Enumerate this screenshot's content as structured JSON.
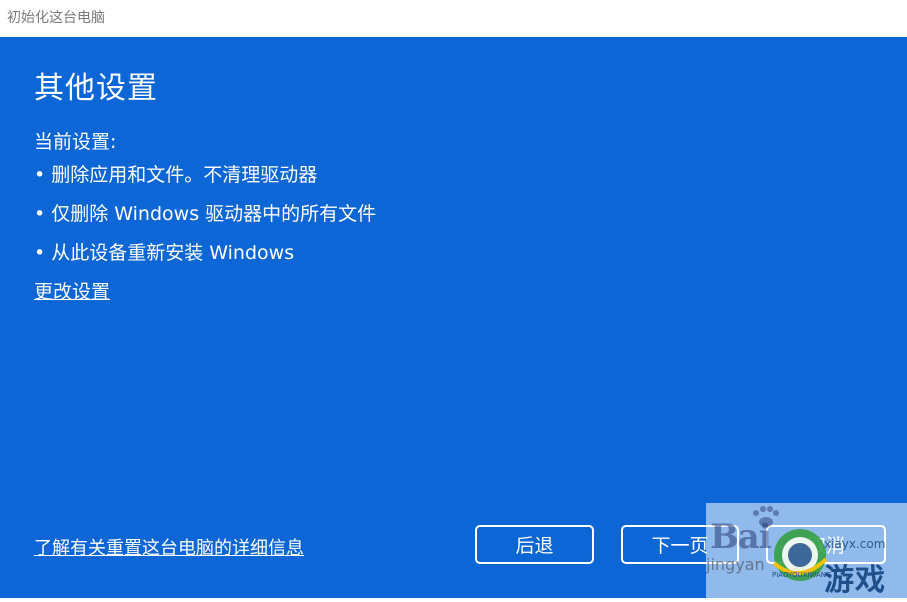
{
  "window": {
    "title": "初始化这台电脑"
  },
  "dialog": {
    "heading": "其他设置",
    "current_settings_label": "当前设置:",
    "bullets": [
      "• 删除应用和文件。不清理驱动器",
      "• 仅删除 Windows 驱动器中的所有文件",
      "•  从此设备重新安装 Windows"
    ],
    "change_settings_link": "更改设置",
    "learn_more_link": "了解有关重置这台电脑的详细信息",
    "buttons": {
      "back": "后退",
      "next": "下一页",
      "cancel": "取消"
    }
  },
  "watermark": {
    "baidu": "Bai",
    "jingyan": "jingyan",
    "site": "xiayx.com",
    "game": "游戏",
    "small": "PIAOYOUXIWANG"
  },
  "colors": {
    "dialog_background": "#0c66d6",
    "title_text": "#7a7a7a",
    "text": "#ffffff"
  }
}
